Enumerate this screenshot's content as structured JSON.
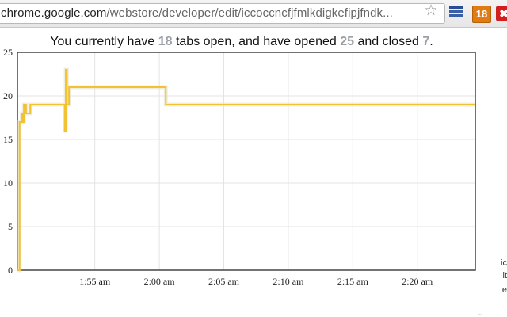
{
  "browser": {
    "url_domain": "chrome.google.com",
    "url_path": "/webstore/developer/edit/iccoccncfjfmlkdigkefipjfndk...",
    "extensions": {
      "tab_count_badge": "18",
      "close_icon": "✖"
    },
    "icons": {
      "star": "bookmark-star-icon",
      "ext1": "menu-lines-icon",
      "ext3": "red-x-icon"
    }
  },
  "popup": {
    "summary": {
      "part1": "You currently have ",
      "open": "18",
      "part2": " tabs open, and have opened ",
      "opened": "25",
      "part3": " and closed ",
      "closed": "7",
      "part4": "."
    }
  },
  "background_fragments": [
    "ic",
    "it",
    "e"
  ],
  "colors": {
    "line": "#f1c232",
    "axis": "#444444",
    "grid": "#e3e3e3",
    "badge": "#e07b14",
    "number": "#9aa0a6"
  },
  "chart_data": {
    "type": "line",
    "title": "",
    "xlabel": "",
    "ylabel": "",
    "ylim": [
      0,
      25
    ],
    "yticks": [
      0,
      5,
      10,
      15,
      20,
      25
    ],
    "xlim": [
      "1:49",
      "2:24:30"
    ],
    "xticks": [
      {
        "t": "1:55",
        "label": "1:55 am"
      },
      {
        "t": "2:00",
        "label": "2:00 am"
      },
      {
        "t": "2:05",
        "label": "2:05 am"
      },
      {
        "t": "2:10",
        "label": "2:10 am"
      },
      {
        "t": "2:15",
        "label": "2:15 am"
      },
      {
        "t": "2:20",
        "label": "2:20 am"
      }
    ],
    "grid": true,
    "series": [
      {
        "x": [
          "1:49",
          "1:49:10",
          "1:49:20",
          "1:49:25",
          "1:49:30",
          "1:49:40",
          "1:50",
          "1:52:30",
          "1:52:40",
          "1:52:45",
          "1:52:50",
          "1:53",
          "2:00:20",
          "2:00:30",
          "2:24:30"
        ],
        "y": [
          0,
          17,
          18,
          17,
          19,
          18,
          19,
          19,
          16,
          23,
          19,
          21,
          21,
          19,
          19
        ]
      }
    ]
  }
}
